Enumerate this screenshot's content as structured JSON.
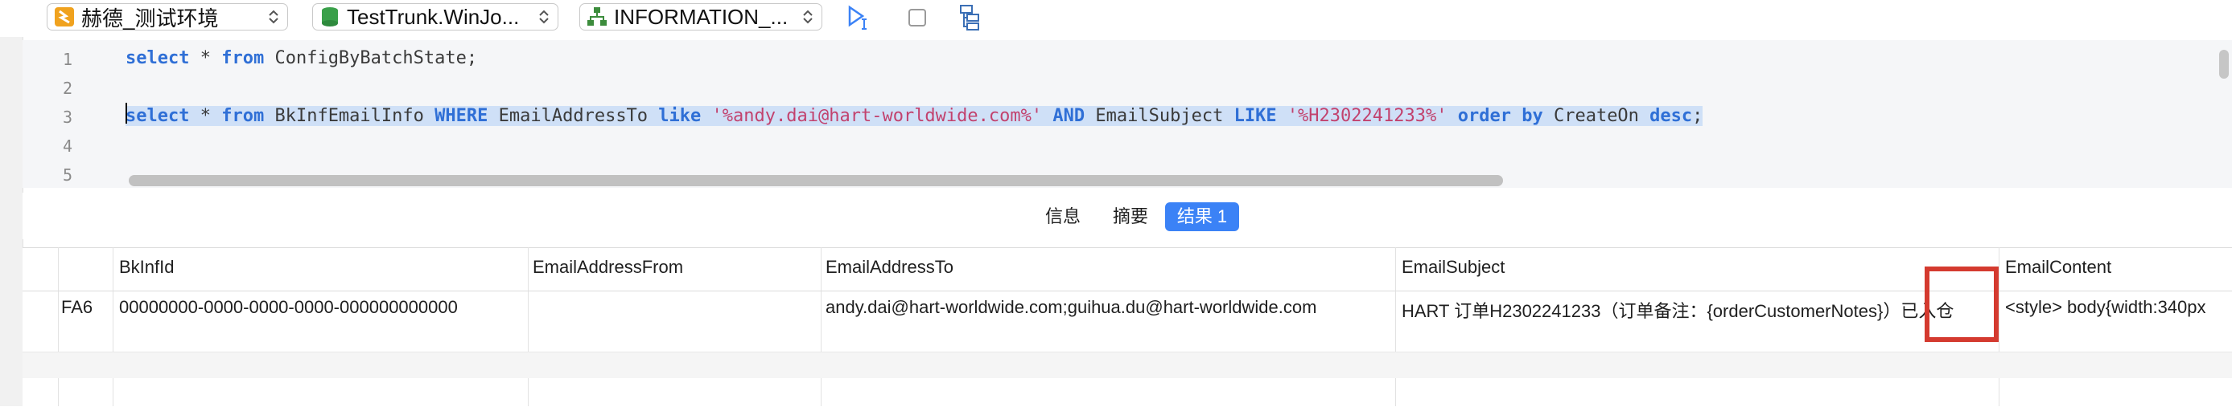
{
  "toolbar": {
    "connection": {
      "label": "赫德_测试环境",
      "color": "#f0a21e"
    },
    "database": {
      "label": "TestTrunk.WinJo...",
      "color": "#3aa04a"
    },
    "schema": {
      "label": "INFORMATION_...",
      "color": "#3c8c3c"
    }
  },
  "editor": {
    "lines": [
      "1",
      "2",
      "3",
      "4",
      "5"
    ],
    "line1": {
      "k1": "select",
      "t1": " * ",
      "k2": "from",
      "t2": " ConfigByBatchState;"
    },
    "line3": {
      "k1": "select",
      "t1": " * ",
      "k2": "from",
      "t2": " BkInfEmailInfo ",
      "k3": "WHERE",
      "t3": " EmailAddressTo ",
      "k4": "like",
      "t4": " ",
      "s1": "'%andy.dai@hart-worldwide.com%'",
      "t5": " ",
      "k5": "AND",
      "t6": " EmailSubject ",
      "k6": "LIKE",
      "t7": " ",
      "s2": "'%H2302241233%'",
      "t8": " ",
      "k7": "order by",
      "t9": " CreateOn ",
      "k8": "desc",
      "t10": ";"
    }
  },
  "result_tabs": [
    "信息",
    "摘要",
    "结果 1"
  ],
  "grid": {
    "columns": [
      "BkInfId",
      "EmailAddressFrom",
      "EmailAddressTo",
      "EmailSubject",
      "EmailContent"
    ],
    "row": {
      "prefix": "FA6",
      "BkInfId": "00000000-0000-0000-0000-000000000000",
      "EmailAddressFrom": "",
      "EmailAddressTo": "andy.dai@hart-worldwide.com;guihua.du@hart-worldwide.com",
      "EmailSubject": "HART  订单H2302241233（订单备注：{orderCustomerNotes}）已入仓",
      "EmailContent": "<style> body{width:340px"
    }
  },
  "colors": {
    "accent": "#3b82f6",
    "highlight_box": "#d43a2f"
  }
}
